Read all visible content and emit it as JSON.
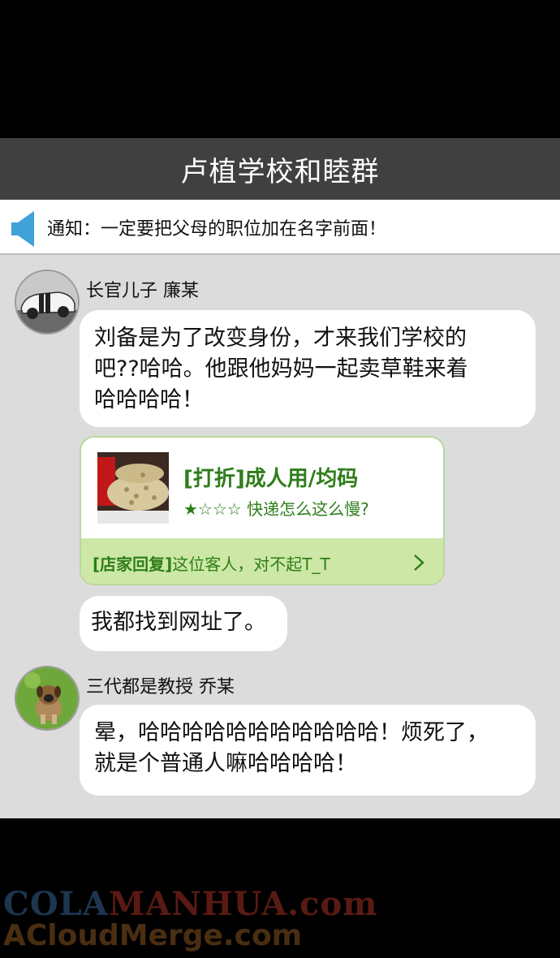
{
  "header": {
    "title": "卢植学校和睦群"
  },
  "notice": {
    "icon": "speaker-icon",
    "text": "通知：一定要把父母的职位加在名字前面！"
  },
  "messages": [
    {
      "user": "长官儿子 廉某",
      "avatar": "sports-car-avatar",
      "lines": [
        "刘备是为了改变身份，才来我们学校的",
        "吧??哈哈。他跟他妈妈一起卖草鞋来着",
        "哈哈哈哈！"
      ]
    },
    {
      "card": {
        "title": "[打折]成人用/均码",
        "subtitle": "★☆☆☆ 快递怎么这么慢?",
        "reply_tag": "[店家回复]",
        "reply_text": "这位客人，对不起T_T"
      }
    },
    {
      "lines": [
        "我都找到网址了。"
      ]
    },
    {
      "user": "三代都是教授 乔某",
      "avatar": "puppy-avatar",
      "lines": [
        "晕，哈哈哈哈哈哈哈哈哈哈哈！烦死了，",
        "就是个普通人嘛哈哈哈哈！"
      ]
    }
  ],
  "watermark": {
    "line1_a": "COLA",
    "line1_b": "MANHUA.com",
    "line2": "ACloudMerge.com"
  },
  "colors": {
    "header_bg": "#404040",
    "chat_bg": "#dcdcdc",
    "card_green": "#2e7d1a",
    "card_foot_bg": "#cde8a6"
  }
}
